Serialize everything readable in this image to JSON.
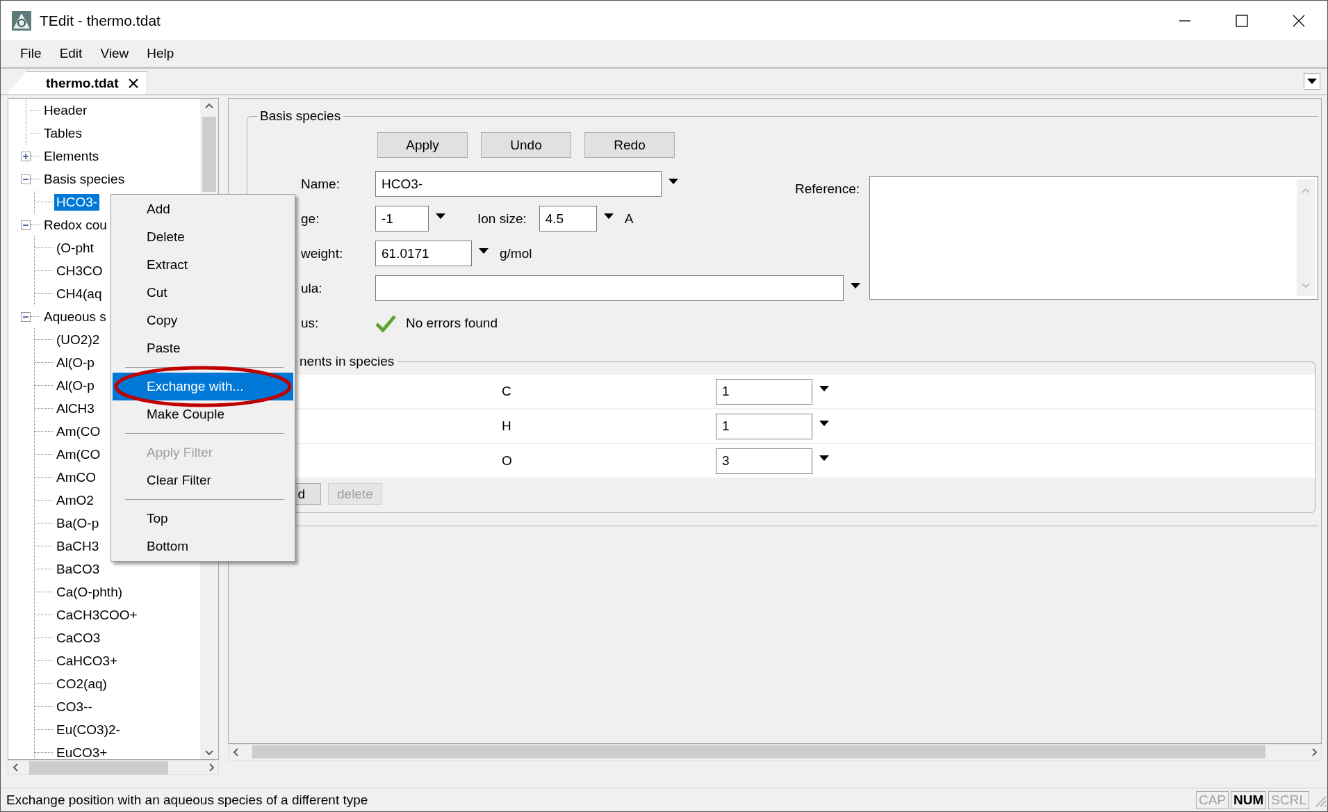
{
  "window": {
    "title": "TEdit - thermo.tdat"
  },
  "menu_bar": [
    "File",
    "Edit",
    "View",
    "Help"
  ],
  "tabs": [
    {
      "label": "thermo.tdat",
      "selected": true
    }
  ],
  "tree": [
    {
      "label": "Header",
      "selected": false
    },
    {
      "label": "Tables",
      "selected": false
    },
    {
      "label": "Elements",
      "selected": false,
      "expanded": false
    },
    {
      "label": "Basis species",
      "selected": false,
      "expanded": true,
      "children": [
        {
          "label": "HCO3-",
          "selected": true
        }
      ]
    },
    {
      "label": "Redox cou",
      "selected": false,
      "expanded": true,
      "children": [
        {
          "label": "(O-pht",
          "selected": false
        },
        {
          "label": "CH3CO",
          "selected": false
        },
        {
          "label": "CH4(aq",
          "selected": false
        }
      ]
    },
    {
      "label": "Aqueous s",
      "selected": false,
      "expanded": true,
      "children": [
        {
          "label": "(UO2)2",
          "selected": false
        },
        {
          "label": "Al(O-p",
          "selected": false
        },
        {
          "label": "Al(O-p",
          "selected": false
        },
        {
          "label": "AlCH3",
          "selected": false
        },
        {
          "label": "Am(CO",
          "selected": false
        },
        {
          "label": "Am(CO",
          "selected": false
        },
        {
          "label": "AmCO",
          "selected": false
        },
        {
          "label": "AmO2",
          "selected": false
        },
        {
          "label": "Ba(O-p",
          "selected": false
        },
        {
          "label": "BaCH3",
          "selected": false
        },
        {
          "label": "BaCO3",
          "selected": false
        },
        {
          "label": "Ca(O-phth)",
          "selected": false
        },
        {
          "label": "CaCH3COO+",
          "selected": false
        },
        {
          "label": "CaCO3",
          "selected": false
        },
        {
          "label": "CaHCO3+",
          "selected": false
        },
        {
          "label": "CO2(aq)",
          "selected": false
        },
        {
          "label": "CO3--",
          "selected": false
        },
        {
          "label": "Eu(CO3)2-",
          "selected": false
        },
        {
          "label": "EuCO3+",
          "selected": false
        }
      ]
    }
  ],
  "context_menu": [
    {
      "kind": "item",
      "label": "Add",
      "selected": false,
      "disabled": false,
      "circled": false
    },
    {
      "kind": "item",
      "label": "Delete",
      "selected": false,
      "disabled": false,
      "circled": false
    },
    {
      "kind": "item",
      "label": "Extract",
      "selected": false,
      "disabled": false,
      "circled": false
    },
    {
      "kind": "item",
      "label": "Cut",
      "selected": false,
      "disabled": false,
      "circled": false
    },
    {
      "kind": "item",
      "label": "Copy",
      "selected": false,
      "disabled": false,
      "circled": false
    },
    {
      "kind": "item",
      "label": "Paste",
      "selected": false,
      "disabled": false,
      "circled": false
    },
    {
      "kind": "separator"
    },
    {
      "kind": "item",
      "label": "Exchange with...",
      "selected": true,
      "disabled": false,
      "circled": true
    },
    {
      "kind": "item",
      "label": "Make Couple",
      "selected": false,
      "disabled": false,
      "circled": false
    },
    {
      "kind": "separator"
    },
    {
      "kind": "item",
      "label": "Apply Filter",
      "selected": false,
      "disabled": true,
      "circled": false
    },
    {
      "kind": "item",
      "label": "Clear Filter",
      "selected": false,
      "disabled": false,
      "circled": false
    },
    {
      "kind": "separator"
    },
    {
      "kind": "item",
      "label": "Top",
      "selected": false,
      "disabled": false,
      "circled": false
    },
    {
      "kind": "item",
      "label": "Bottom",
      "selected": false,
      "disabled": false,
      "circled": false
    }
  ],
  "basis_species": {
    "legend": "Basis species",
    "buttons": [
      "Apply",
      "Undo",
      "Redo"
    ],
    "name": {
      "label": "Name:",
      "value": "HCO3-"
    },
    "reference": {
      "label": "Reference:"
    },
    "charge": {
      "label": "ge:",
      "value": "-1"
    },
    "ion_size": {
      "label": "Ion size:",
      "value": "4.5",
      "unit": "A"
    },
    "weight": {
      "label": "weight:",
      "value": "61.0171",
      "unit": "g/mol"
    },
    "formula": {
      "label": "ula:"
    },
    "status": {
      "label": "us:",
      "text": "No errors found",
      "ok": true
    },
    "elements": {
      "legend": "nents in species",
      "rows": [
        {
          "element": "C",
          "count": "1"
        },
        {
          "element": "H",
          "count": "1"
        },
        {
          "element": "O",
          "count": "3"
        }
      ],
      "buttons": [
        {
          "label": "d",
          "disabled": false
        },
        {
          "label": "delete",
          "disabled": true
        }
      ]
    }
  },
  "status_bar": {
    "text": "Exchange position with an aqueous species of a different type",
    "indicators": [
      {
        "label": "CAP",
        "on": false
      },
      {
        "label": "NUM",
        "on": true
      },
      {
        "label": "SCRL",
        "on": false
      }
    ]
  }
}
